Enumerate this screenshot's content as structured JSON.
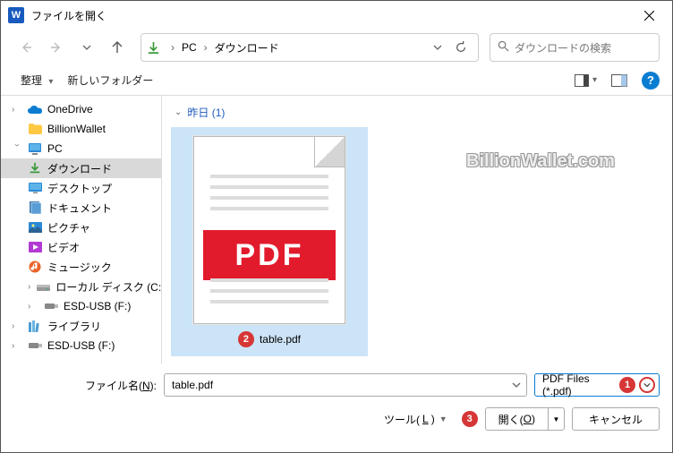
{
  "title": "ファイルを開く",
  "appicon_letter": "W",
  "breadcrumbs": {
    "items": [
      "PC",
      "ダウンロード"
    ]
  },
  "search": {
    "placeholder": "ダウンロードの検索"
  },
  "toolbar": {
    "organize": "整理",
    "new_folder": "新しいフォルダー"
  },
  "sidebar": {
    "items": [
      {
        "label": "OneDrive",
        "type": "onedrive"
      },
      {
        "label": "BillionWallet",
        "type": "folder"
      },
      {
        "label": "PC",
        "type": "pc"
      },
      {
        "label": "ダウンロード",
        "type": "downloads",
        "selected": true
      },
      {
        "label": "デスクトップ",
        "type": "desktop"
      },
      {
        "label": "ドキュメント",
        "type": "documents"
      },
      {
        "label": "ピクチャ",
        "type": "pictures"
      },
      {
        "label": "ビデオ",
        "type": "videos"
      },
      {
        "label": "ミュージック",
        "type": "music"
      },
      {
        "label": "ローカル ディスク (C:)",
        "type": "drive"
      },
      {
        "label": "ESD-USB (F:)",
        "type": "usb"
      },
      {
        "label": "ライブラリ",
        "type": "libraries"
      },
      {
        "label": "ESD-USB (F:)",
        "type": "usb"
      }
    ]
  },
  "content": {
    "group_label": "昨日 (1)",
    "file": {
      "name": "table.pdf",
      "pdf_badge": "PDF"
    }
  },
  "watermark": "BillionWallet.com",
  "filename": {
    "label_pre": "ファイル名(",
    "label_u": "N",
    "label_post": "):",
    "value": "table.pdf"
  },
  "filter": {
    "label": "PDF Files (*.pdf)"
  },
  "buttons": {
    "tools_pre": "ツール(",
    "tools_u": "L",
    "tools_post": ")",
    "open_pre": "開く(",
    "open_u": "O",
    "open_post": ")",
    "cancel": "キャンセル"
  },
  "annot": {
    "b1": "1",
    "b2": "2",
    "b3": "3"
  }
}
